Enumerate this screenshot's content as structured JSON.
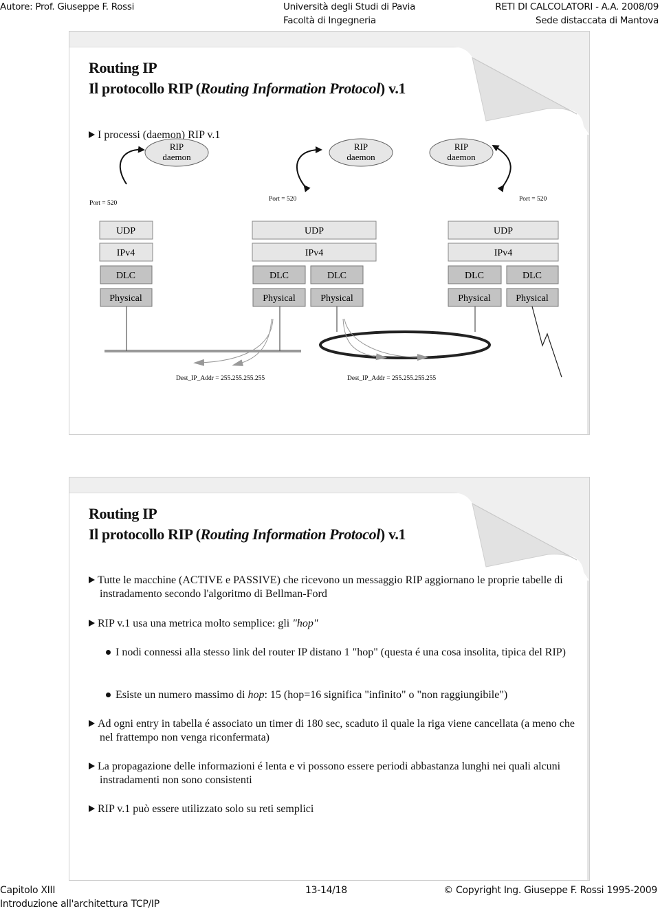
{
  "header": {
    "author": "Autore: Prof. Giuseppe F. Rossi",
    "university": "Università degli Studi di Pavia",
    "faculty": "Facoltà di Ingegneria",
    "course": "RETI DI CALCOLATORI - A.A. 2008/09",
    "site": "Sede distaccata di Mantova"
  },
  "slide1": {
    "title_line1": "Routing IP",
    "title_line2_prefix": "Il protocollo RIP (",
    "title_line2_italic": "Routing Information Protocol",
    "title_line2_suffix": ") v.1",
    "bullet": "I processi (daemon) RIP v.1",
    "diagram": {
      "daemon_label_1": "RIP",
      "daemon_label_2": "daemon",
      "port_label": "Port = 520",
      "layers": {
        "udp": "UDP",
        "ip": "IPv4",
        "dlc": "DLC",
        "phy": "Physical"
      },
      "dest_label": "Dest_IP_Addr = 255.255.255.255"
    }
  },
  "slide2": {
    "title_line1": "Routing IP",
    "title_line2_prefix": "Il protocollo RIP (",
    "title_line2_italic": "Routing Information Protocol",
    "title_line2_suffix": ") v.1",
    "bullets": [
      "Tutte le macchine (ACTIVE e PASSIVE) che ricevono un messaggio RIP aggiornano le proprie tabelle di instradamento secondo l'algoritmo di Bellman-Ford",
      "RIP v.1 usa una metrica molto semplice: gli ",
      "Ad ogni entry in tabella é associato un timer di 180 sec, scaduto il quale la riga viene cancellata (a meno che nel frattempo non venga riconfermata)",
      "La propagazione delle informazioni é lenta e vi possono essere periodi abbastanza lunghi nei quali alcuni instradamenti non sono consistenti",
      "RIP v.1 può essere utilizzato solo su reti semplici"
    ],
    "hop_italic": "\"hop\"",
    "subbullets": [
      "I nodi connessi alla stesso link del router IP distano 1 \"hop\" (questa é una cosa insolita, tipica del RIP)",
      "Esiste un numero massimo di ",
      "hop",
      ": 15 (hop=16 significa \"infinito\" o \"non raggiungibile\")"
    ]
  },
  "footer": {
    "chapter": "Capitolo XIII",
    "subtitle": "Introduzione all'architettura TCP/IP",
    "pages": "13-14/18",
    "copyright": "© Copyright Ing. Giuseppe  F. Rossi 1995-2009"
  }
}
